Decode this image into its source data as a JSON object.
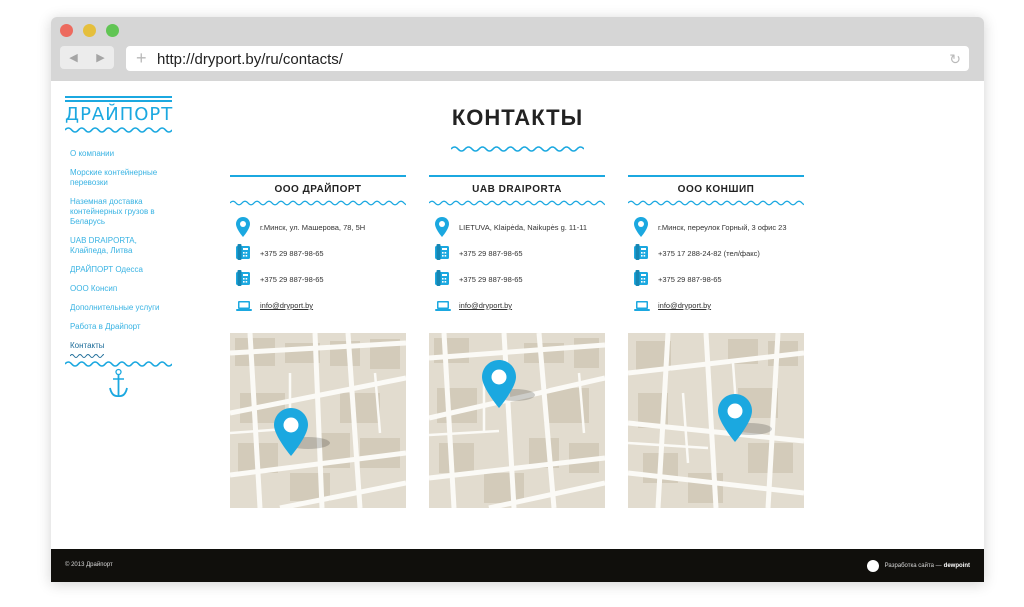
{
  "browser": {
    "url": "http://dryport.by/ru/contacts/",
    "back_icon": "◀",
    "forward_icon": "▶",
    "plus_icon": "+",
    "reload_icon": "↻"
  },
  "sidebar": {
    "logo_text": "ДРАЙПОРТ",
    "items": [
      {
        "label": "О компании"
      },
      {
        "label": "Морские контейнерные перевозки"
      },
      {
        "label": "Наземная доставка контейнерных грузов в Беларусь"
      },
      {
        "label": "UAB DRAIPORTA, Клайпеда, Литва"
      },
      {
        "label": "ДРАЙПОРТ Одесса"
      },
      {
        "label": "ООО Консип"
      },
      {
        "label": "Дополнительные услуги"
      },
      {
        "label": "Работа в Драйпорт"
      },
      {
        "label": "Контакты"
      }
    ]
  },
  "main": {
    "title": "КОНТАКТЫ",
    "columns": [
      {
        "title": "ООО ДРАЙПОРТ",
        "address": "г.Минск, ул. Машерова, 78, 5Н",
        "phone1": "+375 29 887-98-65",
        "phone2": "+375 29 887-98-65",
        "email": "info@dryport.by"
      },
      {
        "title": "UAB DRAIPORTA",
        "address": "LIETUVA, Klaipėda, Naikupės g. 11-11",
        "phone1": "+375 29 887-98-65",
        "phone2": "+375 29 887-98-65",
        "email": "info@dryport.by"
      },
      {
        "title": "ООО КОНШИП",
        "address": "г.Минск, переулок Горный, 3 офис 23",
        "phone1": "+375 17 288-24-82 (тел/факс)",
        "phone2": "+375 29 887-98-65",
        "email": "info@dryport.by"
      }
    ]
  },
  "footer": {
    "copyright": "© 2013 Драйпорт",
    "dev_text": "Разработка сайта —",
    "dev_brand": "dewpoint"
  },
  "colors": {
    "accent": "#1ba8e0",
    "footer_bg": "#100f0c",
    "map_bg": "#e2dccf"
  }
}
